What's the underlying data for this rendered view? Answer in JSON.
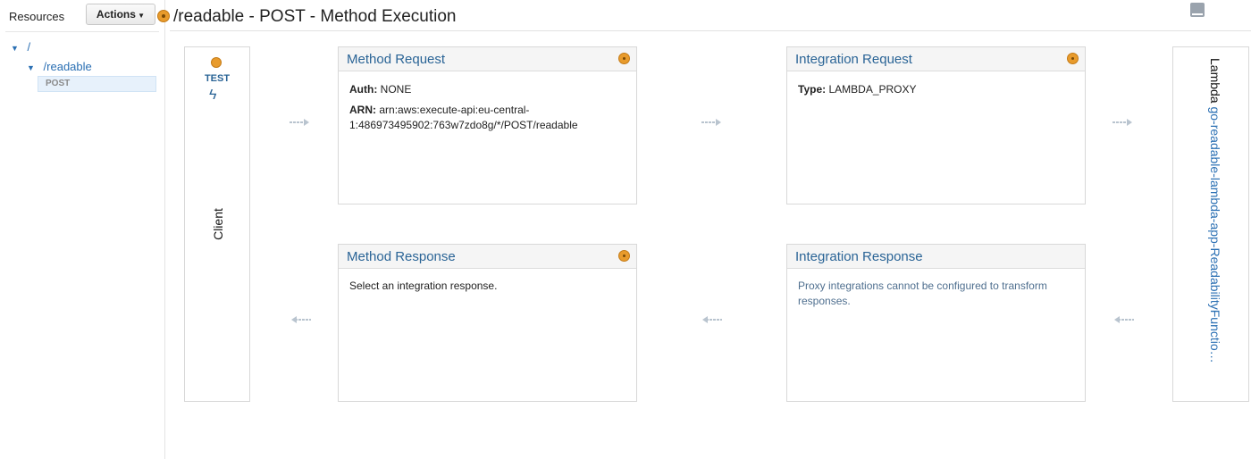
{
  "sidebar": {
    "title": "Resources",
    "actions_label": "Actions",
    "tree": {
      "root": "/",
      "child": "/readable",
      "method": "POST"
    }
  },
  "header": {
    "title": "/readable - POST - Method Execution"
  },
  "client": {
    "test_label": "TEST",
    "label": "Client"
  },
  "method_request": {
    "title": "Method Request",
    "auth_label": "Auth:",
    "auth_value": "NONE",
    "arn_label": "ARN:",
    "arn_value": "arn:aws:execute-api:eu-central-1:486973495902:763w7zdo8g/*/POST/readable"
  },
  "integration_request": {
    "title": "Integration Request",
    "type_label": "Type:",
    "type_value": "LAMBDA_PROXY"
  },
  "method_response": {
    "title": "Method Response",
    "body": "Select an integration response."
  },
  "integration_response": {
    "title": "Integration Response",
    "body": "Proxy integrations cannot be configured to transform responses."
  },
  "lambda": {
    "prefix": "Lambda",
    "function_name": "go-readable-lambda-app-ReadabilityFunctio…"
  },
  "colors": {
    "accent": "#2a6496",
    "gear": "#e89b2c"
  }
}
